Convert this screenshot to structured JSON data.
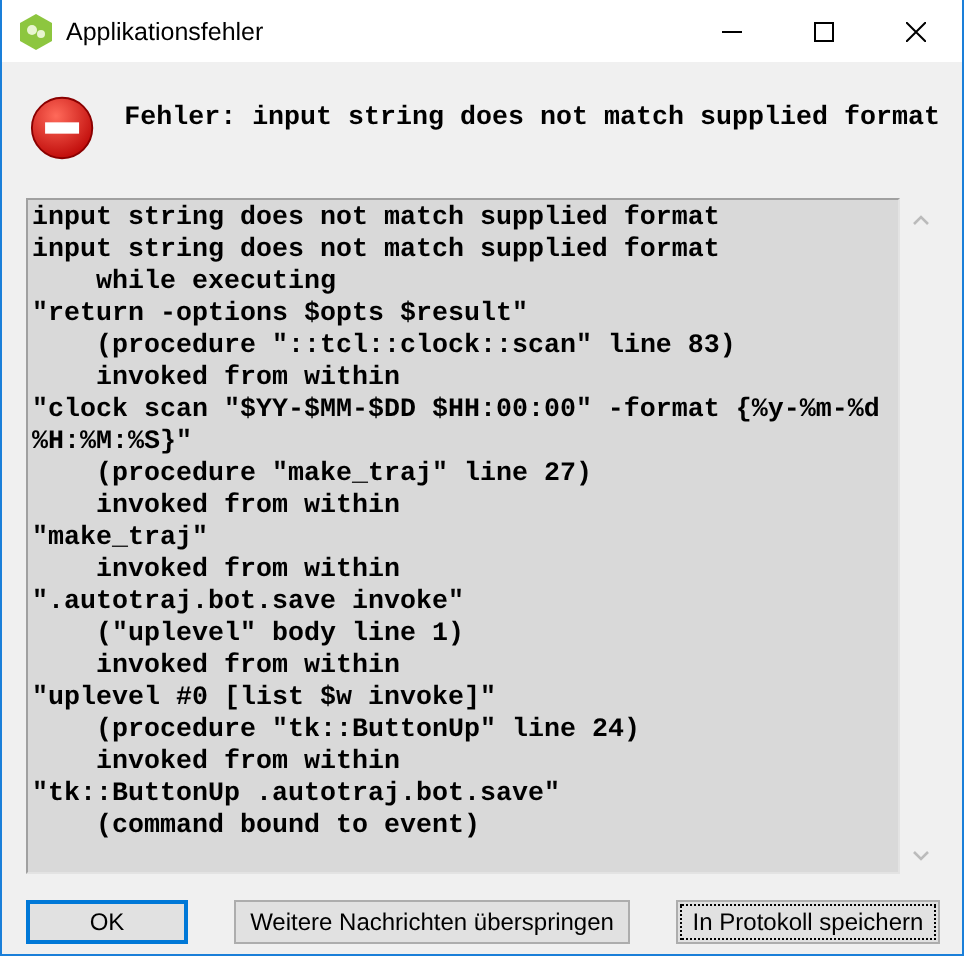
{
  "window": {
    "title": "Applikationsfehler"
  },
  "message": "Fehler: input string does not match supplied format",
  "trace": [
    "input string does not match supplied format",
    "input string does not match supplied format",
    "    while executing",
    "\"return -options $opts $result\"",
    "    (procedure \"::tcl::clock::scan\" line 83)",
    "    invoked from within",
    "\"clock scan \"$YY-$MM-$DD $HH:00:00\" -format {%y-%m-%d %H:%M:%S}\"",
    "    (procedure \"make_traj\" line 27)",
    "    invoked from within",
    "\"make_traj\"",
    "    invoked from within",
    "\".autotraj.bot.save invoke\"",
    "    (\"uplevel\" body line 1)",
    "    invoked from within",
    "\"uplevel #0 [list $w invoke]\"",
    "    (procedure \"tk::ButtonUp\" line 24)",
    "    invoked from within",
    "\"tk::ButtonUp .autotraj.bot.save\"",
    "    (command bound to event)"
  ],
  "buttons": [
    {
      "label": "OK",
      "default": true,
      "focused": false
    },
    {
      "label": "Weitere Nachrichten überspringen",
      "default": false,
      "focused": false
    },
    {
      "label": "In Protokoll speichern",
      "default": false,
      "focused": true
    }
  ]
}
